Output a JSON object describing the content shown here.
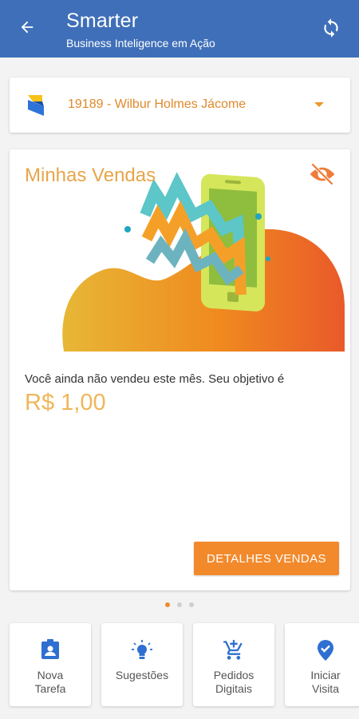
{
  "app_bar": {
    "title": "Smarter",
    "subtitle": "Business Inteligence em Ação",
    "back_icon": "arrow-back-icon",
    "refresh_icon": "sync-icon"
  },
  "client_selector": {
    "value": "19189 - Wilbur Holmes Jácome",
    "logo_icon": "smarter-logo"
  },
  "sales_card": {
    "title": "Minhas Vendas",
    "message": "Você ainda não vendeu este mês. Seu objetivo é",
    "amount": "R$ 1,00",
    "button_label": "DETALHES VENDAS",
    "visibility_icon": "eye-off-icon"
  },
  "pager": {
    "total": 3,
    "active": 0
  },
  "actions": [
    {
      "label_line1": "Nova",
      "label_line2": "Tarefa",
      "icon": "task-badge-icon"
    },
    {
      "label_line1": "Sugestões",
      "label_line2": "",
      "icon": "lightbulb-icon"
    },
    {
      "label_line1": "Pedidos",
      "label_line2": "Digitais",
      "icon": "add-cart-icon"
    },
    {
      "label_line1": "Iniciar",
      "label_line2": "Visita",
      "icon": "verified-location-icon"
    }
  ],
  "colors": {
    "primary": "#3f6fb8",
    "accent": "#f28a2c",
    "title_orange": "#e6a64a",
    "icon_blue": "#2f6fd1"
  }
}
